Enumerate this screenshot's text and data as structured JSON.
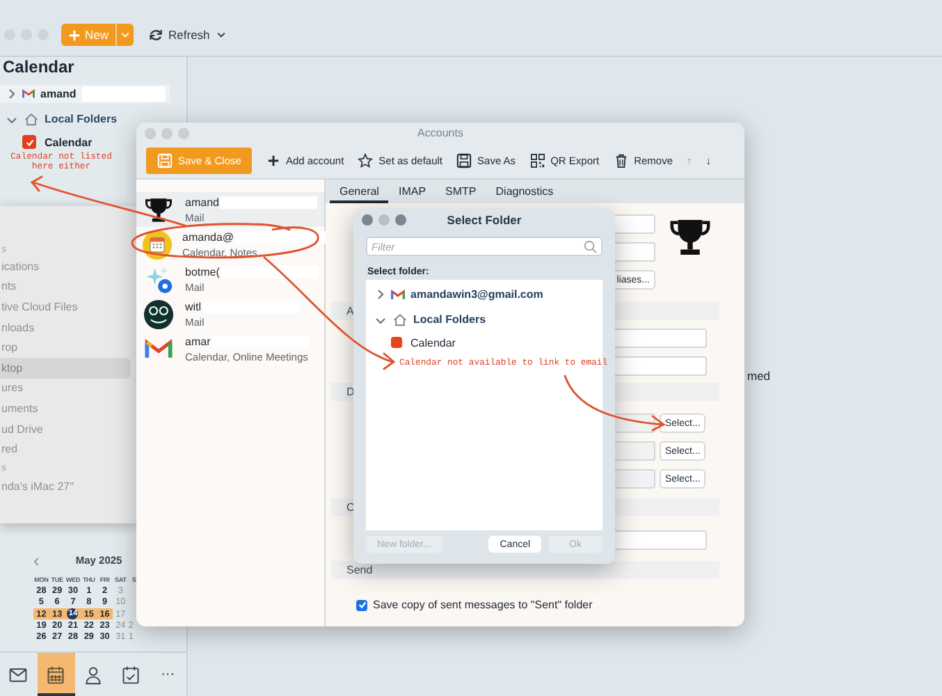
{
  "main_toolbar": {
    "new_button": "New",
    "refresh_button": "Refresh"
  },
  "sidebar": {
    "title": "Calendar",
    "items": [
      {
        "kind": "account",
        "label": "amand",
        "expanded": false,
        "redacted": true
      },
      {
        "kind": "folder_group",
        "label": "Local Folders",
        "expanded": true,
        "children": [
          {
            "label": "Calendar",
            "checked": true,
            "color": "#e0401c"
          }
        ]
      }
    ]
  },
  "finder_sidebar": {
    "items": [
      {
        "kind": "header",
        "label": "s"
      },
      {
        "kind": "item",
        "label": "ications",
        "selected": false
      },
      {
        "kind": "item",
        "label": "nts",
        "selected": false
      },
      {
        "kind": "item",
        "label": "tive Cloud Files",
        "selected": false
      },
      {
        "kind": "item",
        "label": "nloads",
        "selected": false
      },
      {
        "kind": "item",
        "label": "rop",
        "selected": false
      },
      {
        "kind": "item",
        "label": "ktop",
        "selected": true
      },
      {
        "kind": "item",
        "label": "ures",
        "selected": false
      },
      {
        "kind": "item",
        "label": "uments",
        "selected": false
      },
      {
        "kind": "item",
        "label": "ud Drive",
        "selected": false
      },
      {
        "kind": "item",
        "label": "red",
        "selected": false
      },
      {
        "kind": "header",
        "label": "s"
      },
      {
        "kind": "item",
        "label": "nda's iMac 27\"",
        "selected": false
      }
    ]
  },
  "mini_calendar": {
    "prev": "‹",
    "month": "May 2025",
    "weekdays": [
      "MON",
      "TUE",
      "WED",
      "THU",
      "FRI",
      "SAT",
      "S"
    ],
    "weeks": [
      [
        {
          "day": "28",
          "kind": "weekday",
          "selected": false,
          "today": false
        },
        {
          "day": "29",
          "kind": "weekday",
          "selected": false,
          "today": false
        },
        {
          "day": "30",
          "kind": "weekday",
          "selected": false,
          "today": false
        },
        {
          "day": "1",
          "kind": "weekday",
          "selected": false,
          "today": false
        },
        {
          "day": "2",
          "kind": "weekday",
          "selected": false,
          "today": false
        },
        {
          "day": "3",
          "kind": "weekend",
          "selected": false,
          "today": false
        }
      ],
      [
        {
          "day": "5",
          "kind": "weekday",
          "selected": false,
          "today": false
        },
        {
          "day": "6",
          "kind": "weekday",
          "selected": false,
          "today": false
        },
        {
          "day": "7",
          "kind": "weekday",
          "selected": false,
          "today": false
        },
        {
          "day": "8",
          "kind": "weekday",
          "selected": false,
          "today": false
        },
        {
          "day": "9",
          "kind": "weekday",
          "selected": false,
          "today": false
        },
        {
          "day": "10",
          "kind": "weekend",
          "selected": false,
          "today": false
        }
      ],
      [
        {
          "day": "12",
          "kind": "weekday",
          "selected": true,
          "today": false
        },
        {
          "day": "13",
          "kind": "weekday",
          "selected": true,
          "today": false
        },
        {
          "day": "14",
          "kind": "weekday",
          "selected": true,
          "today": true
        },
        {
          "day": "15",
          "kind": "weekday",
          "selected": true,
          "today": false
        },
        {
          "day": "16",
          "kind": "weekday",
          "selected": true,
          "today": false
        },
        {
          "day": "17",
          "kind": "weekend",
          "selected": false,
          "today": false
        }
      ],
      [
        {
          "day": "19",
          "kind": "weekday",
          "selected": false,
          "today": false
        },
        {
          "day": "20",
          "kind": "weekday",
          "selected": false,
          "today": false
        },
        {
          "day": "21",
          "kind": "weekday",
          "selected": false,
          "today": false
        },
        {
          "day": "22",
          "kind": "weekday",
          "selected": false,
          "today": false
        },
        {
          "day": "23",
          "kind": "weekday",
          "selected": false,
          "today": false
        },
        {
          "day": "24",
          "kind": "weekend",
          "selected": false,
          "today": false
        },
        {
          "day": "2",
          "kind": "weekend",
          "selected": false,
          "today": false
        }
      ],
      [
        {
          "day": "26",
          "kind": "weekday",
          "selected": false,
          "today": false
        },
        {
          "day": "27",
          "kind": "weekday",
          "selected": false,
          "today": false
        },
        {
          "day": "28",
          "kind": "weekday",
          "selected": false,
          "today": false
        },
        {
          "day": "29",
          "kind": "weekday",
          "selected": false,
          "today": false
        },
        {
          "day": "30",
          "kind": "weekday",
          "selected": false,
          "today": false
        },
        {
          "day": "31",
          "kind": "weekend",
          "selected": false,
          "today": false
        },
        {
          "day": "1",
          "kind": "weekend",
          "selected": false,
          "today": false
        }
      ]
    ]
  },
  "nav_bar": {
    "items": [
      {
        "kind": "mail",
        "selected": false
      },
      {
        "kind": "calendar",
        "selected": true
      },
      {
        "kind": "contacts",
        "selected": false
      },
      {
        "kind": "tasks",
        "selected": false
      },
      {
        "kind": "more",
        "label": "···",
        "selected": false
      }
    ]
  },
  "content_text": "med",
  "accounts_window": {
    "title": "Accounts",
    "toolbar": [
      {
        "kind": "primary",
        "label": "Save & Close",
        "disabled": false
      },
      {
        "kind": "tool",
        "label": "Add account",
        "disabled": false
      },
      {
        "kind": "tool",
        "label": "Set as default",
        "disabled": false
      },
      {
        "kind": "tool",
        "label": "Save As",
        "disabled": false
      },
      {
        "kind": "tool",
        "label": "QR Export",
        "disabled": false
      },
      {
        "kind": "tool",
        "label": "Remove",
        "disabled": false
      },
      {
        "kind": "arrow",
        "label": "↑",
        "disabled": true
      },
      {
        "kind": "arrow",
        "label": "↓",
        "disabled": false
      }
    ],
    "accounts": [
      {
        "name": "amand",
        "services": "Mail",
        "selected": true,
        "redacted": true
      },
      {
        "name": "amanda@",
        "services": "Calendar, Notes",
        "selected": false,
        "redacted": true
      },
      {
        "name": "botme(",
        "services": "Mail",
        "selected": false,
        "redacted": true
      },
      {
        "name": "witl",
        "services": "Mail",
        "selected": false,
        "redacted": true
      },
      {
        "name": "amar",
        "services": "Calendar, Online Meetings",
        "selected": false,
        "redacted": true
      }
    ],
    "tabs": [
      {
        "label": "General",
        "selected": true
      },
      {
        "label": "IMAP",
        "selected": false
      },
      {
        "label": "SMTP",
        "selected": false
      },
      {
        "label": "Diagnostics",
        "selected": false
      }
    ],
    "aliases_button": "liases...",
    "sections": [
      {
        "label": "A"
      },
      {
        "label": "D"
      },
      {
        "label": "C"
      },
      {
        "label": "Send"
      }
    ],
    "select_buttons": [
      "Select...",
      "Select...",
      "Select..."
    ],
    "save_copy": {
      "label": "Save copy of sent messages to \"Sent\" folder",
      "checked": true
    }
  },
  "select_folder_dialog": {
    "title": "Select Folder",
    "filter": {
      "placeholder": "Filter"
    },
    "list_label": "Select folder:",
    "folders": [
      {
        "kind": "account",
        "label": "amandawin3@gmail.com",
        "expanded": false
      },
      {
        "kind": "local",
        "label": "Local Folders",
        "expanded": true,
        "children": [
          {
            "label": "Calendar",
            "color": "#e8431a"
          }
        ]
      }
    ],
    "buttons": [
      {
        "label": "New folder...",
        "disabled": true
      },
      {
        "label": "Cancel",
        "disabled": false
      },
      {
        "label": "Ok",
        "disabled": true
      }
    ]
  },
  "annotations": [
    {
      "text": "Calendar not listed here either"
    },
    {
      "text": "Calendar not available to link to email"
    }
  ]
}
